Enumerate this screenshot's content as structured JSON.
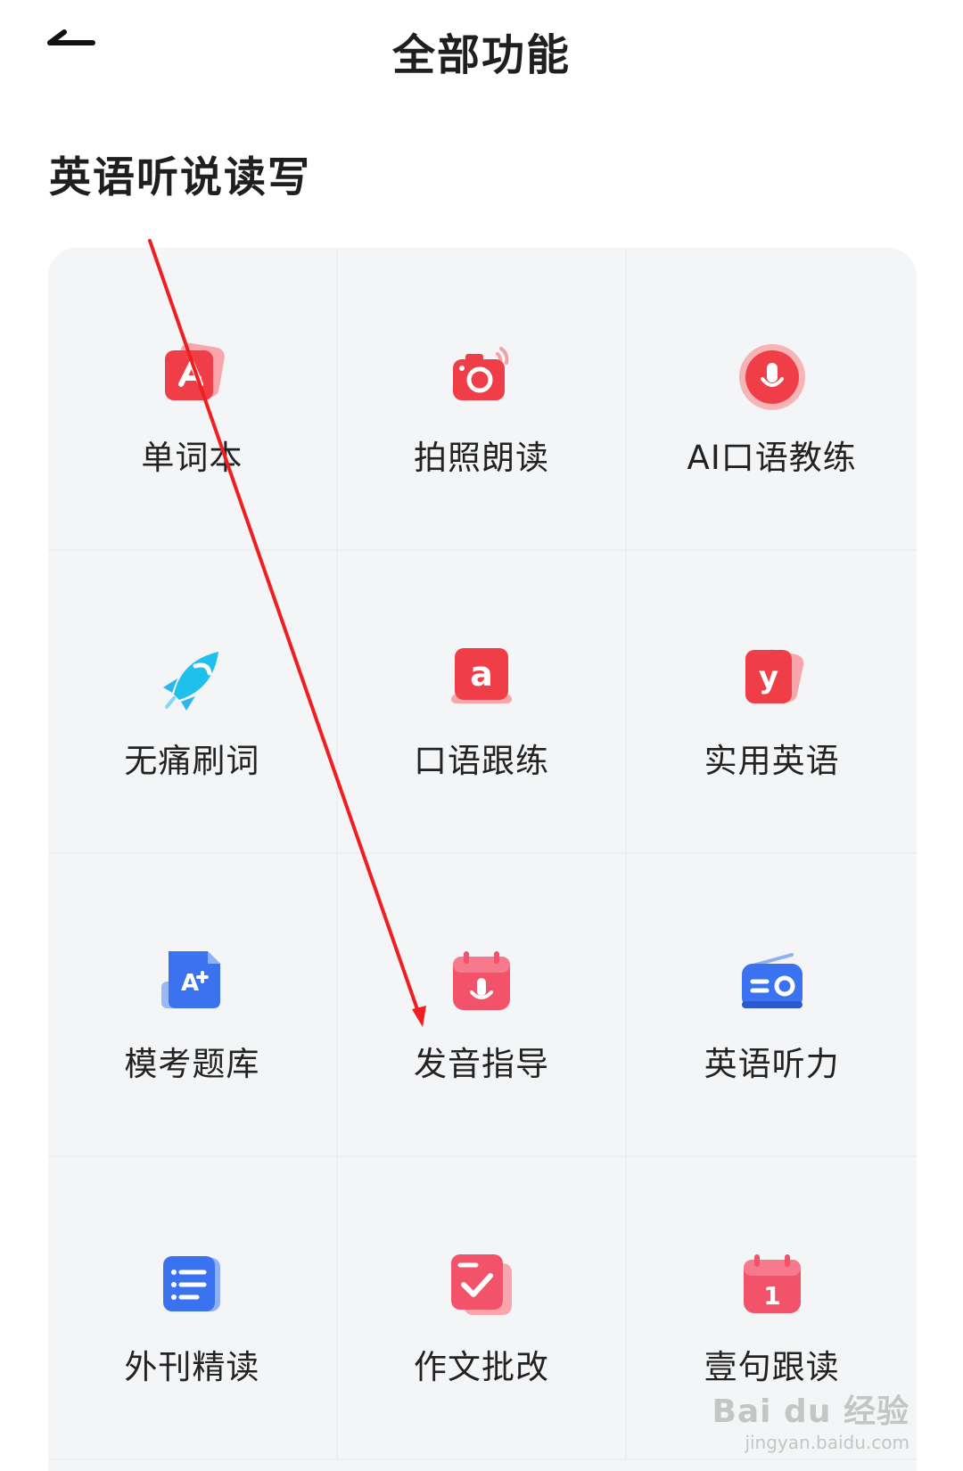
{
  "header": {
    "title": "全部功能"
  },
  "section": {
    "title": "英语听说读写"
  },
  "grid": [
    {
      "label": "单词本",
      "icon": "vocabulary-book-icon"
    },
    {
      "label": "拍照朗读",
      "icon": "camera-read-icon"
    },
    {
      "label": "AI口语教练",
      "icon": "microphone-icon"
    },
    {
      "label": "无痛刷词",
      "icon": "rocket-icon"
    },
    {
      "label": "口语跟练",
      "icon": "letter-a-book-icon"
    },
    {
      "label": "实用英语",
      "icon": "letter-y-card-icon"
    },
    {
      "label": "模考题库",
      "icon": "a-plus-document-icon"
    },
    {
      "label": "发音指导",
      "icon": "calendar-microphone-icon"
    },
    {
      "label": "英语听力",
      "icon": "radio-icon"
    },
    {
      "label": "外刊精读",
      "icon": "article-list-icon"
    },
    {
      "label": "作文批改",
      "icon": "checkmark-card-icon"
    },
    {
      "label": "壹句跟读",
      "icon": "calendar-one-icon"
    }
  ],
  "watermark": {
    "main": "Bai du 经验",
    "sub": "jingyan.baidu.com"
  },
  "colors": {
    "background": "#ffffff",
    "grid_bg": "#f4f5f7",
    "accent_red": "#f0414f",
    "annotation_arrow": "#f01e1e"
  }
}
